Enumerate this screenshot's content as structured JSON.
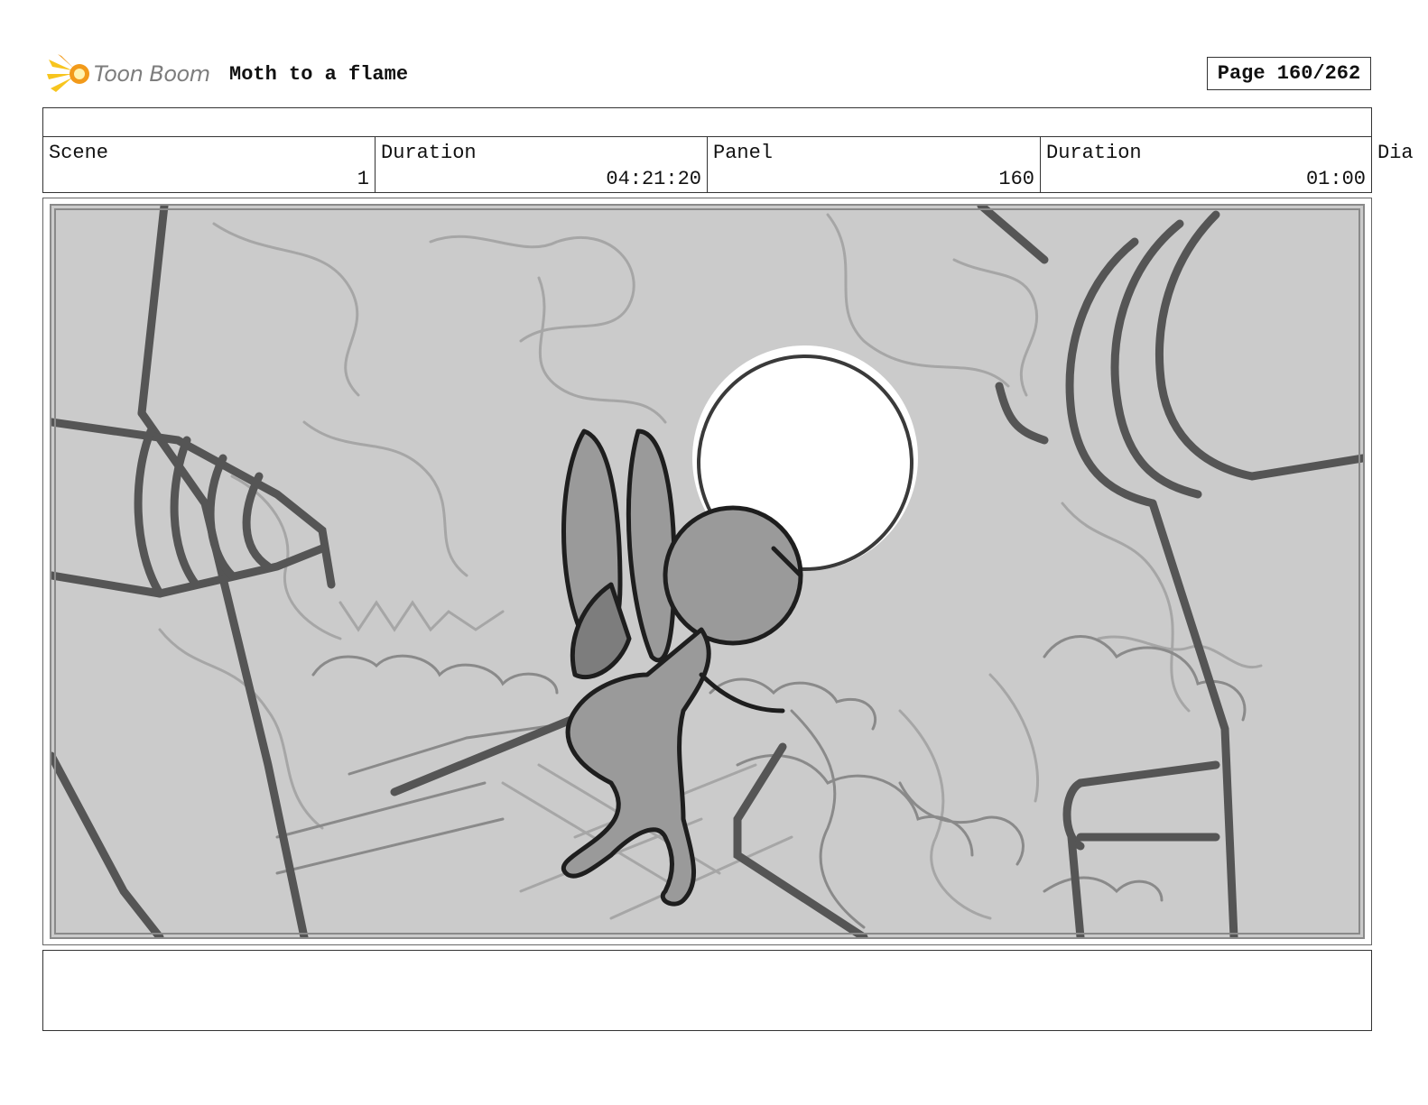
{
  "header": {
    "logo_text": "Toon Boom",
    "logo_icon": "toon-boom-star-icon",
    "project_title": "Moth to a flame",
    "page_label": "Page 160/262"
  },
  "info": {
    "scene_label": "Scene",
    "scene_value": "1",
    "scene_duration_label": "Duration",
    "scene_duration_value": "04:21:20",
    "panel_label": "Panel",
    "panel_value": "160",
    "panel_duration_label": "Duration",
    "panel_duration_value": "01:00",
    "dialogue_label_partial": "Dia"
  },
  "colors": {
    "logo_yellow": "#f7c51e",
    "logo_orange": "#f29a1a",
    "panel_bg": "#cbcbcb",
    "sketch_dark": "#4a4a4a",
    "sketch_light": "#9a9a9a"
  }
}
